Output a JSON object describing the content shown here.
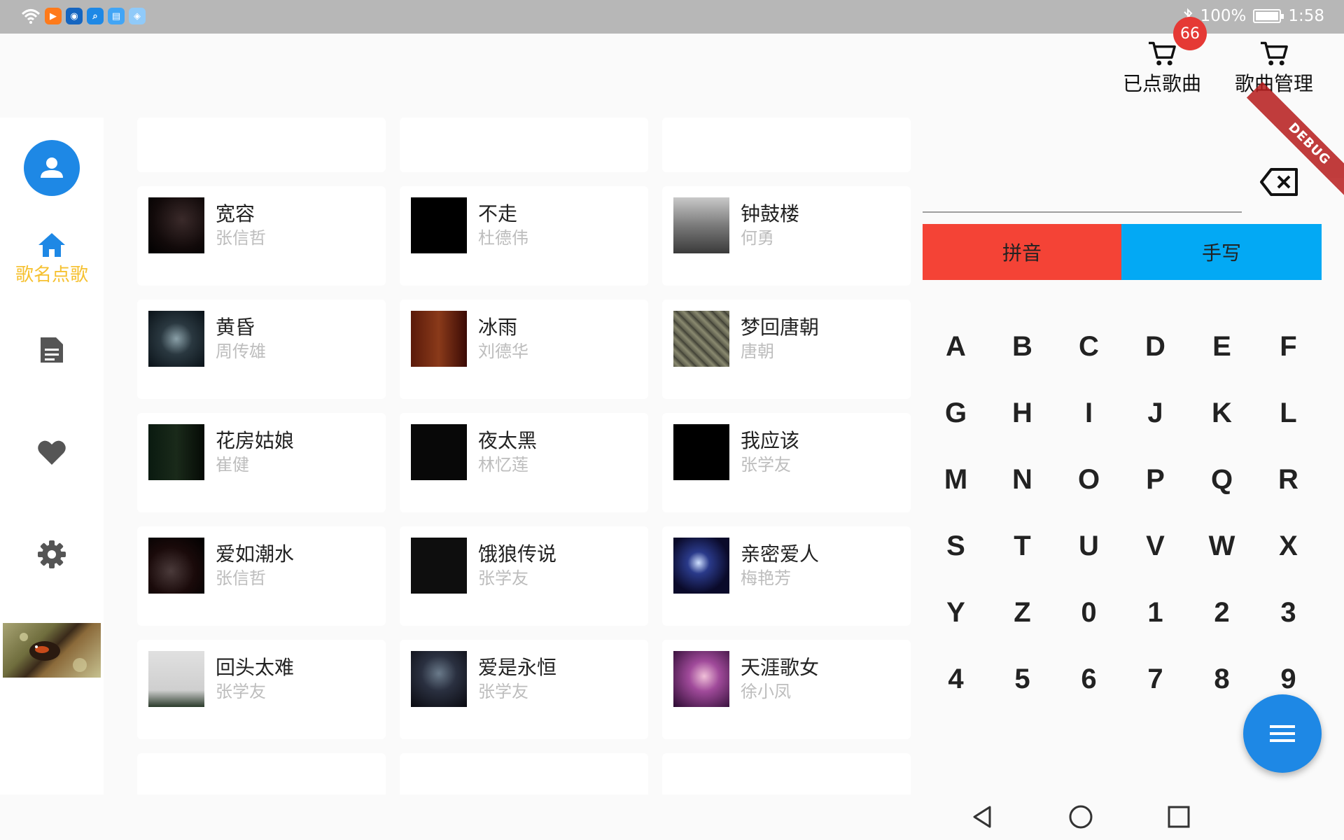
{
  "status_bar": {
    "battery": "100%",
    "time": "1:58"
  },
  "header": {
    "ordered_label": "已点歌曲",
    "ordered_count": "66",
    "manage_label": "歌曲管理",
    "debug": "DEBUG"
  },
  "sidebar": {
    "home_label": "歌名点歌"
  },
  "songs": [
    {
      "title": "宽容",
      "artist": "张信哲"
    },
    {
      "title": "不走",
      "artist": "杜德伟"
    },
    {
      "title": "钟鼓楼",
      "artist": "何勇"
    },
    {
      "title": "黄昏",
      "artist": "周传雄"
    },
    {
      "title": "冰雨",
      "artist": "刘德华"
    },
    {
      "title": "梦回唐朝",
      "artist": "唐朝"
    },
    {
      "title": "花房姑娘",
      "artist": "崔健"
    },
    {
      "title": "夜太黑",
      "artist": "林忆莲"
    },
    {
      "title": "我应该",
      "artist": "张学友"
    },
    {
      "title": "爱如潮水",
      "artist": "张信哲"
    },
    {
      "title": "饿狼传说",
      "artist": "张学友"
    },
    {
      "title": "亲密爱人",
      "artist": "梅艳芳"
    },
    {
      "title": "回头太难",
      "artist": "张学友"
    },
    {
      "title": "爱是永恒",
      "artist": "张学友"
    },
    {
      "title": "天涯歌女",
      "artist": "徐小凤"
    }
  ],
  "keyboard": {
    "tab_pinyin": "拼音",
    "tab_handwrite": "手写",
    "keys": [
      "A",
      "B",
      "C",
      "D",
      "E",
      "F",
      "G",
      "H",
      "I",
      "J",
      "K",
      "L",
      "M",
      "N",
      "O",
      "P",
      "Q",
      "R",
      "S",
      "T",
      "U",
      "V",
      "W",
      "X",
      "Y",
      "Z",
      "0",
      "1",
      "2",
      "3",
      "4",
      "5",
      "6",
      "7",
      "8",
      "9"
    ]
  }
}
